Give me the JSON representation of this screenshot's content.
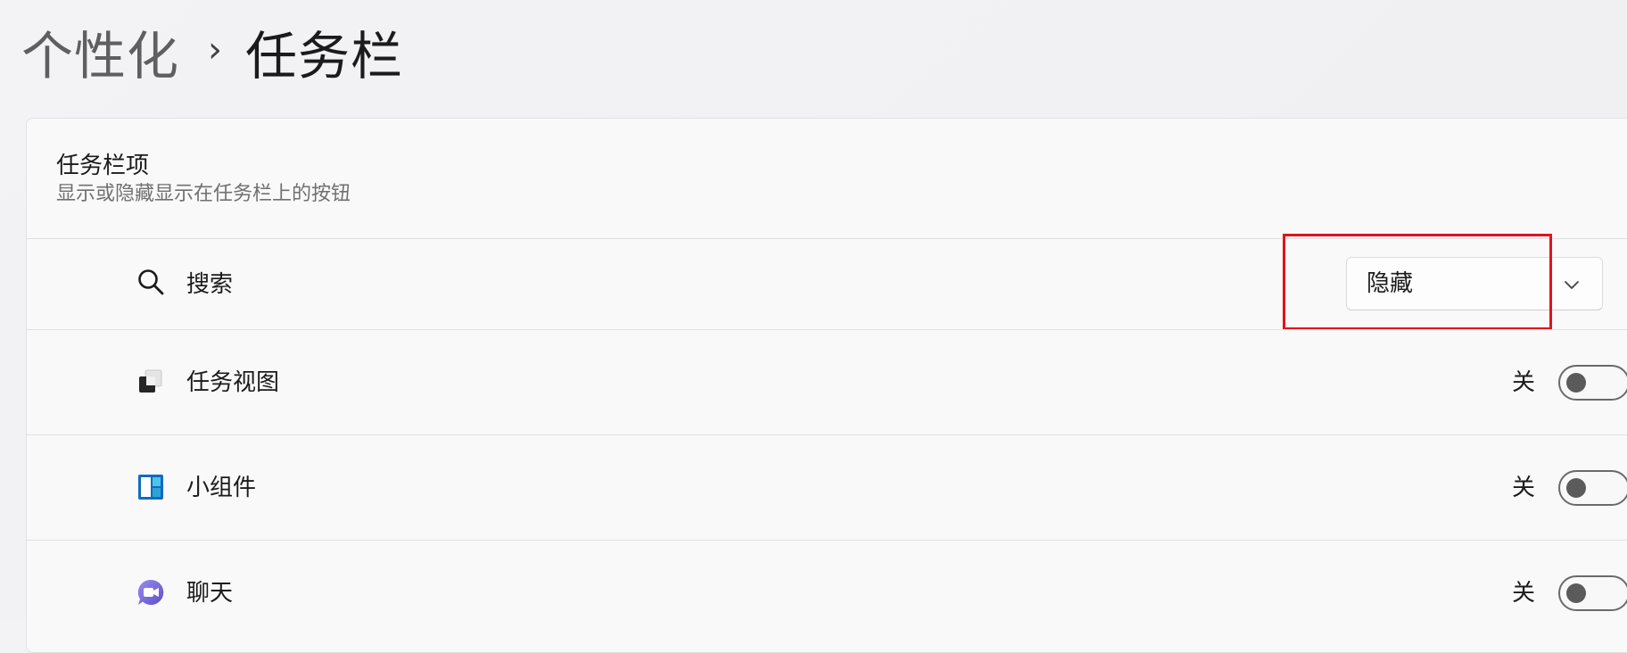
{
  "breadcrumb": {
    "parent": "个性化",
    "separator": "›",
    "current": "任务栏"
  },
  "section": {
    "title": "任务栏项",
    "subtitle": "显示或隐藏显示在任务栏上的按钮"
  },
  "items": [
    {
      "label": "搜索",
      "icon": "search-icon",
      "control": "dropdown",
      "value": "隐藏"
    },
    {
      "label": "任务视图",
      "icon": "task-view-icon",
      "control": "toggle",
      "state_label": "关",
      "on": false
    },
    {
      "label": "小组件",
      "icon": "widgets-icon",
      "control": "toggle",
      "state_label": "关",
      "on": false
    },
    {
      "label": "聊天",
      "icon": "chat-icon",
      "control": "toggle",
      "state_label": "关",
      "on": false
    }
  ],
  "colors": {
    "highlight": "#e0141e",
    "widgets_accent": "#0f6cbd",
    "chat_accent": "#7b6fd8"
  }
}
